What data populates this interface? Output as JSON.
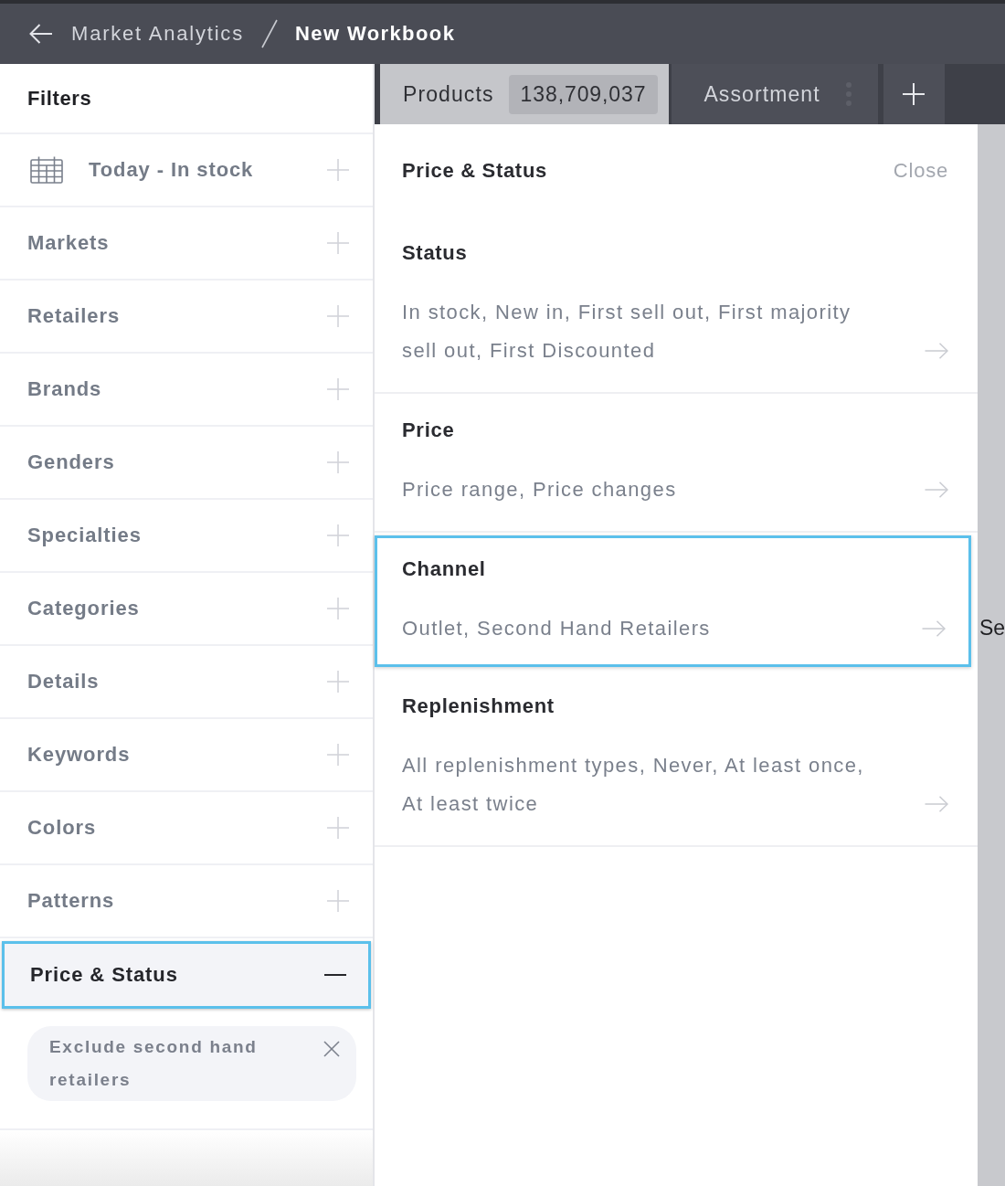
{
  "top_bar": {
    "breadcrumb": "Market Analytics",
    "title": "New Workbook"
  },
  "sidebar": {
    "title": "Filters",
    "items": [
      {
        "label": "Today - In stock",
        "kind": "date",
        "expanded": false,
        "highlighted": false
      },
      {
        "label": "Markets",
        "kind": "filter",
        "expanded": false,
        "highlighted": false
      },
      {
        "label": "Retailers",
        "kind": "filter",
        "expanded": false,
        "highlighted": false
      },
      {
        "label": "Brands",
        "kind": "filter",
        "expanded": false,
        "highlighted": false
      },
      {
        "label": "Genders",
        "kind": "filter",
        "expanded": false,
        "highlighted": false
      },
      {
        "label": "Specialties",
        "kind": "filter",
        "expanded": false,
        "highlighted": false
      },
      {
        "label": "Categories",
        "kind": "filter",
        "expanded": false,
        "highlighted": false
      },
      {
        "label": "Details",
        "kind": "filter",
        "expanded": false,
        "highlighted": false
      },
      {
        "label": "Keywords",
        "kind": "filter",
        "expanded": false,
        "highlighted": false
      },
      {
        "label": "Colors",
        "kind": "filter",
        "expanded": false,
        "highlighted": false
      },
      {
        "label": "Patterns",
        "kind": "filter",
        "expanded": false,
        "highlighted": false
      },
      {
        "label": "Price & Status",
        "kind": "filter",
        "expanded": true,
        "highlighted": true,
        "chips": [
          {
            "label": "Exclude second hand retailers"
          }
        ]
      }
    ]
  },
  "tabs": [
    {
      "label": "Products",
      "count": "138,709,037",
      "selected": true,
      "menu": false
    },
    {
      "label": "Assortment",
      "selected": false,
      "menu": true
    }
  ],
  "panel": {
    "title": "Price & Status",
    "close": "Close",
    "sections": [
      {
        "title": "Status",
        "summary": "In stock, New in, First sell out, First majority sell out, First Discounted",
        "highlighted": false
      },
      {
        "title": "Price",
        "summary": "Price range, Price changes",
        "highlighted": false
      },
      {
        "title": "Channel",
        "summary": "Outlet, Second Hand Retailers",
        "highlighted": true
      },
      {
        "title": "Replenishment",
        "summary": "All replenishment types, Never, At least once, At least twice",
        "highlighted": false
      }
    ]
  },
  "side_text": "Se"
}
